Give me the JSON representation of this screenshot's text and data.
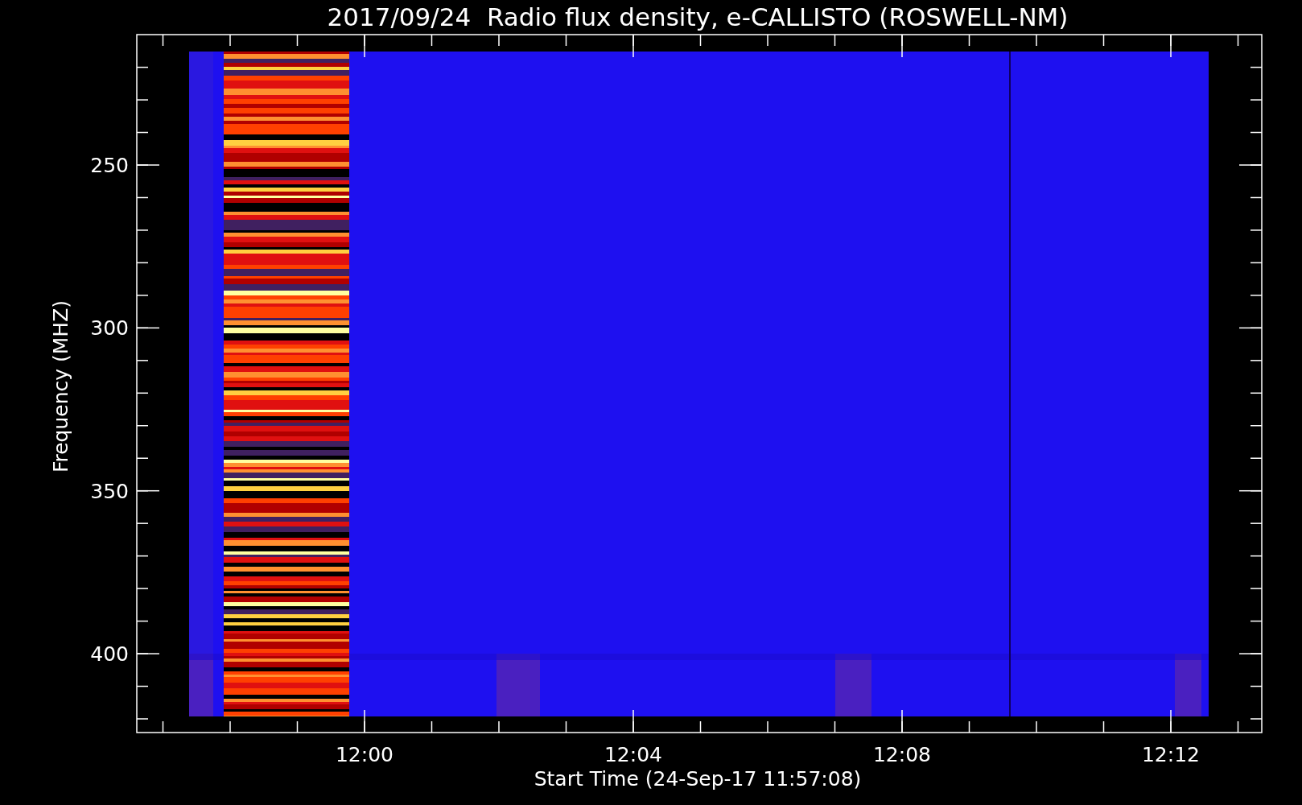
{
  "title": "2017/09/24  Radio flux density, e-CALLISTO (ROSWELL-NM)",
  "xlabel": "Start Time (24-Sep-17 11:57:08)",
  "ylabel": "Frequency (MHZ)",
  "xticks": [
    "12:00",
    "12:04",
    "12:08",
    "12:12"
  ],
  "yticks": [
    "250",
    "300",
    "350",
    "400"
  ]
}
